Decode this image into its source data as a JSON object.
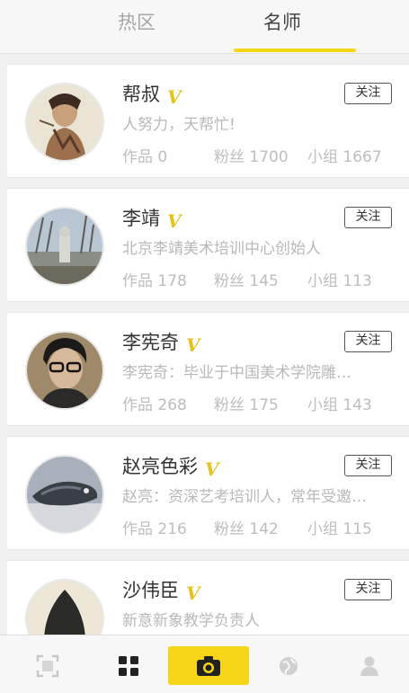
{
  "tabs": [
    {
      "label": "热区"
    },
    {
      "label": "名师"
    }
  ],
  "teachers": [
    {
      "name": "帮叔",
      "follow_label": "关注",
      "desc": "人努力，天帮忙!",
      "works": "作品 0",
      "fans": "粉丝 1700",
      "groups": "小组 1667"
    },
    {
      "name": "李靖",
      "follow_label": "关注",
      "desc": "北京李靖美术培训中心创始人",
      "works": "作品 178",
      "fans": "粉丝 145",
      "groups": "小组 113"
    },
    {
      "name": "李宪奇",
      "follow_label": "关注",
      "desc": "李宪奇：毕业于中国美术学院雕…",
      "works": "作品 268",
      "fans": "粉丝 175",
      "groups": "小组 143"
    },
    {
      "name": "赵亮色彩",
      "follow_label": "关注",
      "desc": "赵亮：资深艺考培训人，常年受邀…",
      "works": "作品 216",
      "fans": "粉丝 142",
      "groups": "小组 115"
    },
    {
      "name": "沙伟臣",
      "follow_label": "关注",
      "desc": "新意新象教学负责人",
      "works": "",
      "fans": "",
      "groups": ""
    }
  ],
  "verified_badge": "V",
  "bottom_nav": {
    "items": [
      "scan-icon",
      "grid-icon",
      "camera-icon",
      "globe-icon",
      "person-icon"
    ]
  },
  "colors": {
    "accent": "#f6d417",
    "badge": "#e7c21a"
  }
}
